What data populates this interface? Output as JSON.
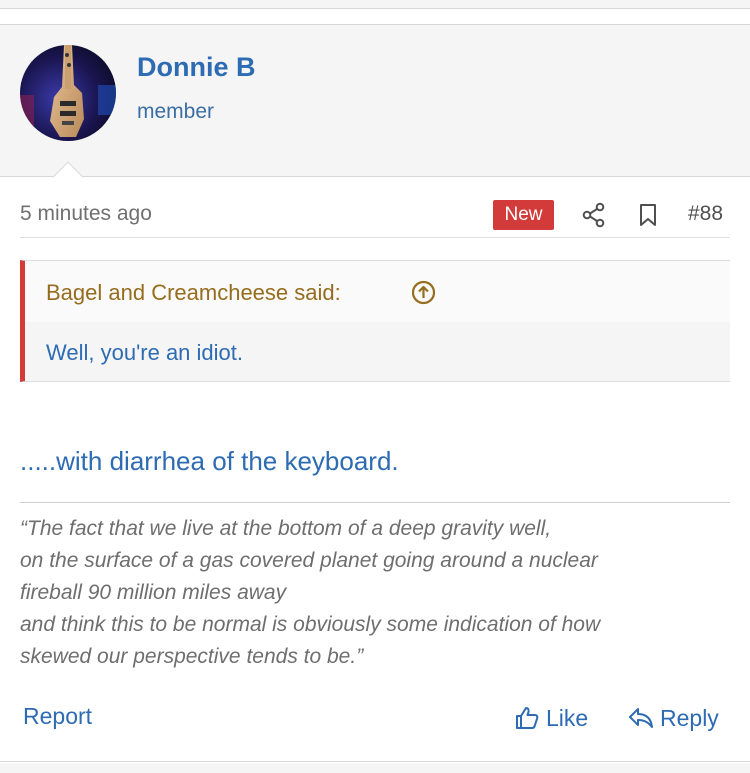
{
  "user": {
    "name": "Donnie B",
    "title": "member"
  },
  "meta": {
    "time": "5 minutes ago",
    "badge": "New",
    "post_number": "#88"
  },
  "quote": {
    "author": "Bagel and Creamcheese said:",
    "text": "Well, you're an idiot."
  },
  "message": ".....with diarrhea of the keyboard.",
  "signature": {
    "lines": [
      "“The fact that we live at the bottom of a deep gravity well,",
      "on the surface of a gas covered planet going around a nuclear",
      "fireball 90 million miles away",
      "and think this to be normal is obviously some indication of how",
      "skewed our perspective tends to be.”"
    ]
  },
  "actions": {
    "report": "Report",
    "like": "Like",
    "reply": "Reply"
  },
  "colors": {
    "link": "#2d6bb3",
    "badge": "#d33b3b",
    "quote_author": "#966c1e"
  },
  "icons": [
    "share-icon",
    "bookmark-icon",
    "arrow-up-circle-icon",
    "thumbs-up-icon",
    "reply-arrow-icon"
  ]
}
